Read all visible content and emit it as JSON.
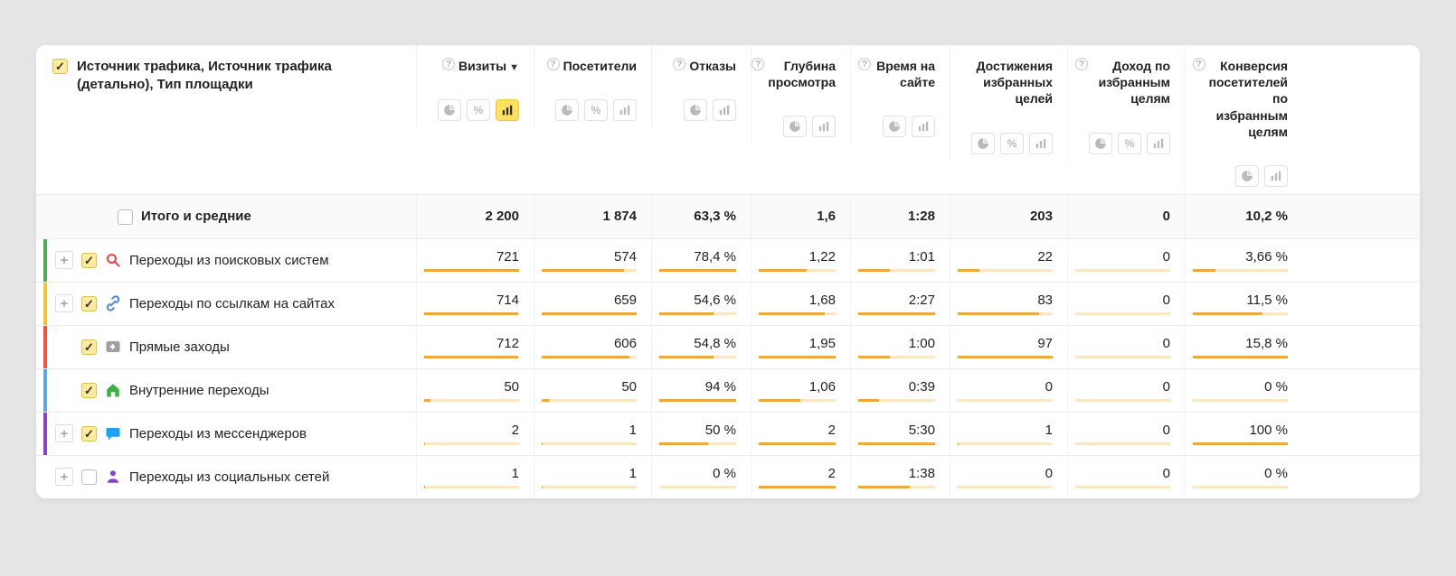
{
  "dimension_header": "Источник трафика, Источник трафика (детально), Тип площадки",
  "columns": [
    {
      "label": "Визиты",
      "help": true,
      "sorted": true,
      "icons": [
        "pie",
        "percent",
        "bars"
      ],
      "active_icon": 2
    },
    {
      "label": "Посетители",
      "help": true,
      "icons": [
        "pie",
        "percent",
        "bars"
      ]
    },
    {
      "label": "Отказы",
      "help": true,
      "icons": [
        "pie",
        "bars"
      ]
    },
    {
      "label": "Глубина просмотра",
      "help": true,
      "icons": [
        "pie",
        "bars"
      ]
    },
    {
      "label": "Время на сайте",
      "help": true,
      "icons": [
        "pie",
        "bars"
      ]
    },
    {
      "label": "Достижения избранных целей",
      "help": false,
      "icons": [
        "pie",
        "percent",
        "bars"
      ]
    },
    {
      "label": "Доход по избранным целям",
      "help": true,
      "icons": [
        "pie",
        "percent",
        "bars"
      ]
    },
    {
      "label": "Конверсия посетителей по избранным целям",
      "help": true,
      "icons": [
        "pie",
        "bars"
      ]
    }
  ],
  "totals": {
    "label": "Итого и средние",
    "values": [
      "2 200",
      "1 874",
      "63,3 %",
      "1,6",
      "1:28",
      "203",
      "0",
      "10,2 %"
    ]
  },
  "rows": [
    {
      "accent": "#4caf50",
      "checked": true,
      "expandable": true,
      "icon": "search",
      "icon_color": "#e23b3b",
      "name": "Переходы из поисковых систем",
      "values": [
        "721",
        "574",
        "78,4 %",
        "1,22",
        "1:01",
        "22",
        "0",
        "3,66 %"
      ],
      "bars": [
        100,
        87,
        100,
        62,
        41,
        23,
        0,
        24
      ]
    },
    {
      "accent": "#f4c430",
      "checked": true,
      "expandable": true,
      "icon": "link",
      "icon_color": "#3b7de2",
      "name": "Переходы по ссылкам на сайтах",
      "values": [
        "714",
        "659",
        "54,6 %",
        "1,68",
        "2:27",
        "83",
        "0",
        "11,5 %"
      ],
      "bars": [
        99,
        100,
        70,
        86,
        100,
        86,
        0,
        73
      ]
    },
    {
      "accent": "#ff4d3a",
      "checked": true,
      "expandable": false,
      "icon": "arrow",
      "icon_color": "#9e9e9e",
      "name": "Прямые заходы",
      "values": [
        "712",
        "606",
        "54,8 %",
        "1,95",
        "1:00",
        "97",
        "0",
        "15,8 %"
      ],
      "bars": [
        99,
        92,
        70,
        100,
        41,
        100,
        0,
        100
      ]
    },
    {
      "accent": "#5aa6e6",
      "checked": true,
      "expandable": false,
      "icon": "home",
      "icon_color": "#3cb043",
      "name": "Внутренние переходы",
      "values": [
        "50",
        "50",
        "94 %",
        "1,06",
        "0:39",
        "0",
        "0",
        "0 %"
      ],
      "bars": [
        7,
        8,
        100,
        54,
        27,
        0,
        0,
        0
      ]
    },
    {
      "accent": "#8a3fd1",
      "checked": true,
      "expandable": true,
      "icon": "chat",
      "icon_color": "#1da1f2",
      "name": "Переходы из мессенджеров",
      "values": [
        "2",
        "1",
        "50 %",
        "2",
        "5:30",
        "1",
        "0",
        "100 %"
      ],
      "bars": [
        0.3,
        0.2,
        64,
        100,
        100,
        1,
        0,
        100
      ]
    },
    {
      "accent": "transparent",
      "checked": false,
      "expandable": true,
      "icon": "social",
      "icon_color": "#8a3fd1",
      "name": "Переходы из социальных сетей",
      "values": [
        "1",
        "1",
        "0 %",
        "2",
        "1:38",
        "0",
        "0",
        "0 %"
      ],
      "bars": [
        0.1,
        0.2,
        0,
        100,
        67,
        0,
        0,
        0
      ]
    }
  ]
}
